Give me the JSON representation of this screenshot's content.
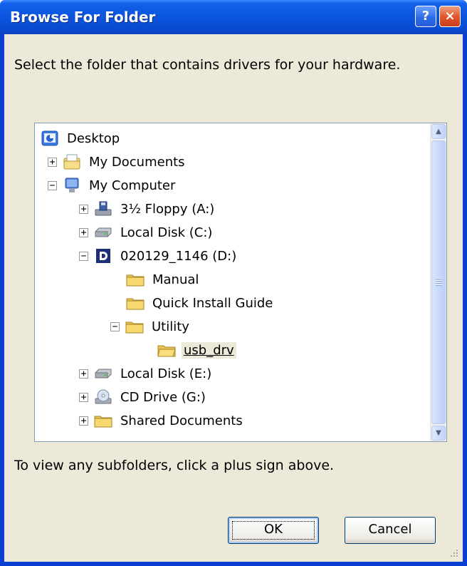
{
  "dialog": {
    "title": "Browse For Folder",
    "help_button": "?",
    "close_button": "×",
    "instruction": "Select the folder that contains drivers for your hardware.",
    "hint": "To view any subfolders, click a plus sign above.",
    "ok_label": "OK",
    "cancel_label": "Cancel"
  },
  "tree": {
    "items": [
      {
        "label": "Desktop",
        "icon": "desktop-icon",
        "expander": ""
      },
      {
        "label": "My Documents",
        "icon": "my-documents-icon",
        "expander": "+"
      },
      {
        "label": "My Computer",
        "icon": "my-computer-icon",
        "expander": "−"
      },
      {
        "label": "3½ Floppy (A:)",
        "icon": "floppy-drive-icon",
        "expander": "+"
      },
      {
        "label": "Local Disk (C:)",
        "icon": "hard-disk-icon",
        "expander": "+"
      },
      {
        "label": "020129_1146 (D:)",
        "icon": "d-link-drive-icon",
        "expander": "−"
      },
      {
        "label": "Manual",
        "icon": "folder-icon",
        "expander": ""
      },
      {
        "label": "Quick Install Guide",
        "icon": "folder-icon",
        "expander": ""
      },
      {
        "label": "Utility",
        "icon": "folder-icon",
        "expander": "−"
      },
      {
        "label": "usb_drv",
        "icon": "folder-open-icon",
        "expander": "",
        "selected": true
      },
      {
        "label": "Local Disk (E:)",
        "icon": "hard-disk-icon",
        "expander": "+"
      },
      {
        "label": "CD Drive (G:)",
        "icon": "cd-drive-icon",
        "expander": "+"
      },
      {
        "label": "Shared Documents",
        "icon": "folder-icon",
        "expander": "+"
      }
    ]
  },
  "colors": {
    "titlebar": "#0a4cd4",
    "client_bg": "#ece9d8",
    "folder": "#f5d36a"
  }
}
